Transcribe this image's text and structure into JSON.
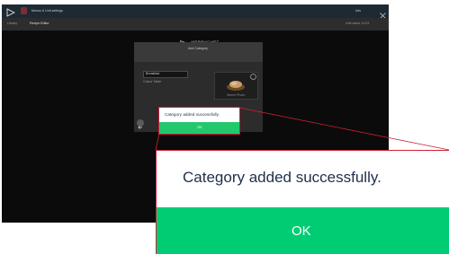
{
  "titlebar": {
    "app_title": "Menus & Unit settings",
    "user_label": "Info",
    "colors": {
      "bar": "#1d2a33",
      "badge": "#7a2e36"
    }
  },
  "breadcrumb": {
    "root": "Library",
    "current": "Recipe Editor",
    "right_info": "Unit name   11:23"
  },
  "header": {
    "brand": "MERRYCHEF"
  },
  "add_category": {
    "title": "Add Category",
    "name_value": "Breakfast",
    "color_label": "Colour Table",
    "photo_label": "Select Photo"
  },
  "dialog": {
    "message": "Category added successfully.",
    "ok_label": "OK",
    "colors": {
      "ok": "#00cc74",
      "callout": "#cf1f35"
    }
  }
}
